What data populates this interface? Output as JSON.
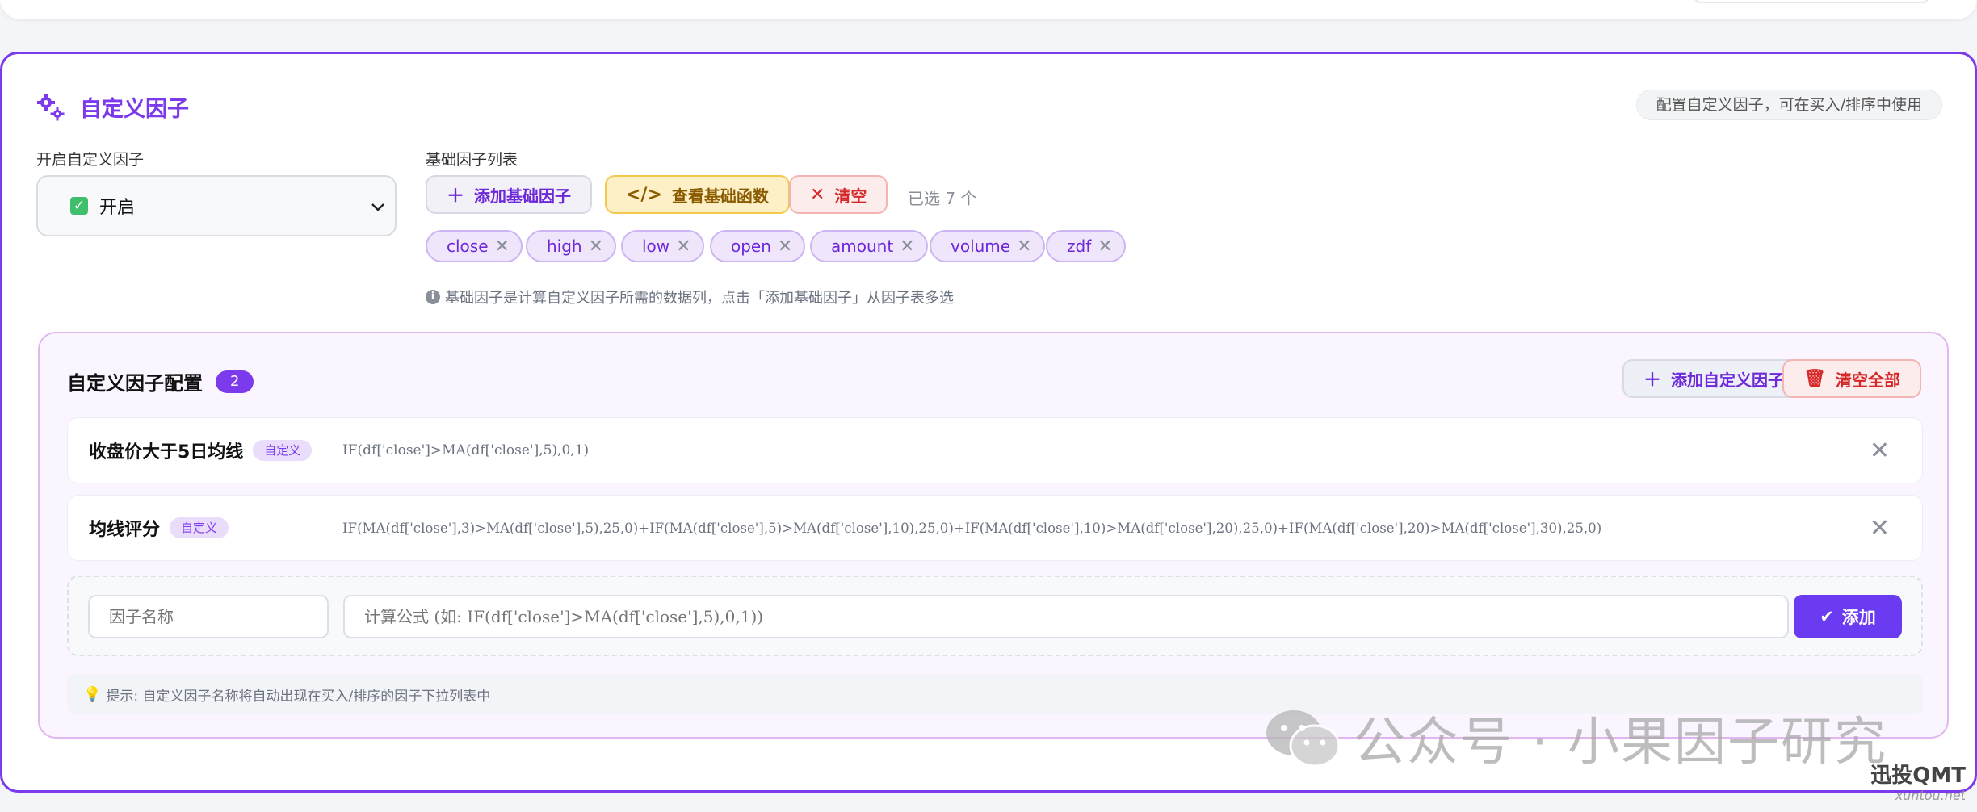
{
  "section": {
    "title": "自定义因子",
    "hint": "配置自定义因子，可在买入/排序中使用"
  },
  "enable": {
    "label": "开启自定义因子",
    "value": "开启"
  },
  "base": {
    "label": "基础因子列表",
    "add_label": "添加基础因子",
    "view_label": "查看基础函数",
    "clear_label": "清空",
    "selected_text": "已选 7 个",
    "tags": [
      "close",
      "high",
      "low",
      "open",
      "amount",
      "volume",
      "zdf"
    ],
    "info": "基础因子是计算自定义因子所需的数据列，点击「添加基础因子」从因子表多选"
  },
  "custom": {
    "title": "自定义因子配置",
    "count": "2",
    "add_label": "添加自定义因子",
    "clear_all_label": "清空全部",
    "rows": [
      {
        "name": "收盘价大于5日均线",
        "badge": "自定义",
        "formula": "IF(df['close']>MA(df['close'],5),0,1)"
      },
      {
        "name": "均线评分",
        "badge": "自定义",
        "formula": "IF(MA(df['close'],3)>MA(df['close'],5),25,0)+IF(MA(df['close'],5)>MA(df['close'],10),25,0)+IF(MA(df['close'],10)>MA(df['close'],20),25,0)+IF(MA(df['close'],20)>MA(df['close'],30),25,0)"
      }
    ],
    "name_placeholder": "因子名称",
    "formula_placeholder": "计算公式 (如: IF(df['close']>MA(df['close'],5),0,1))",
    "add_button": "添加",
    "tip": "提示: 自定义因子名称将自动出现在买入/排序的因子下拉列表中"
  },
  "watermark": {
    "text": "公众号 · 小果因子研究",
    "brand": "迅投QMT",
    "url": "xuntou.net"
  },
  "colors": {
    "accent": "#7c3aed",
    "danger": "#d62828",
    "warning_bg": "#fdefc6",
    "success": "#3fbf6b"
  }
}
